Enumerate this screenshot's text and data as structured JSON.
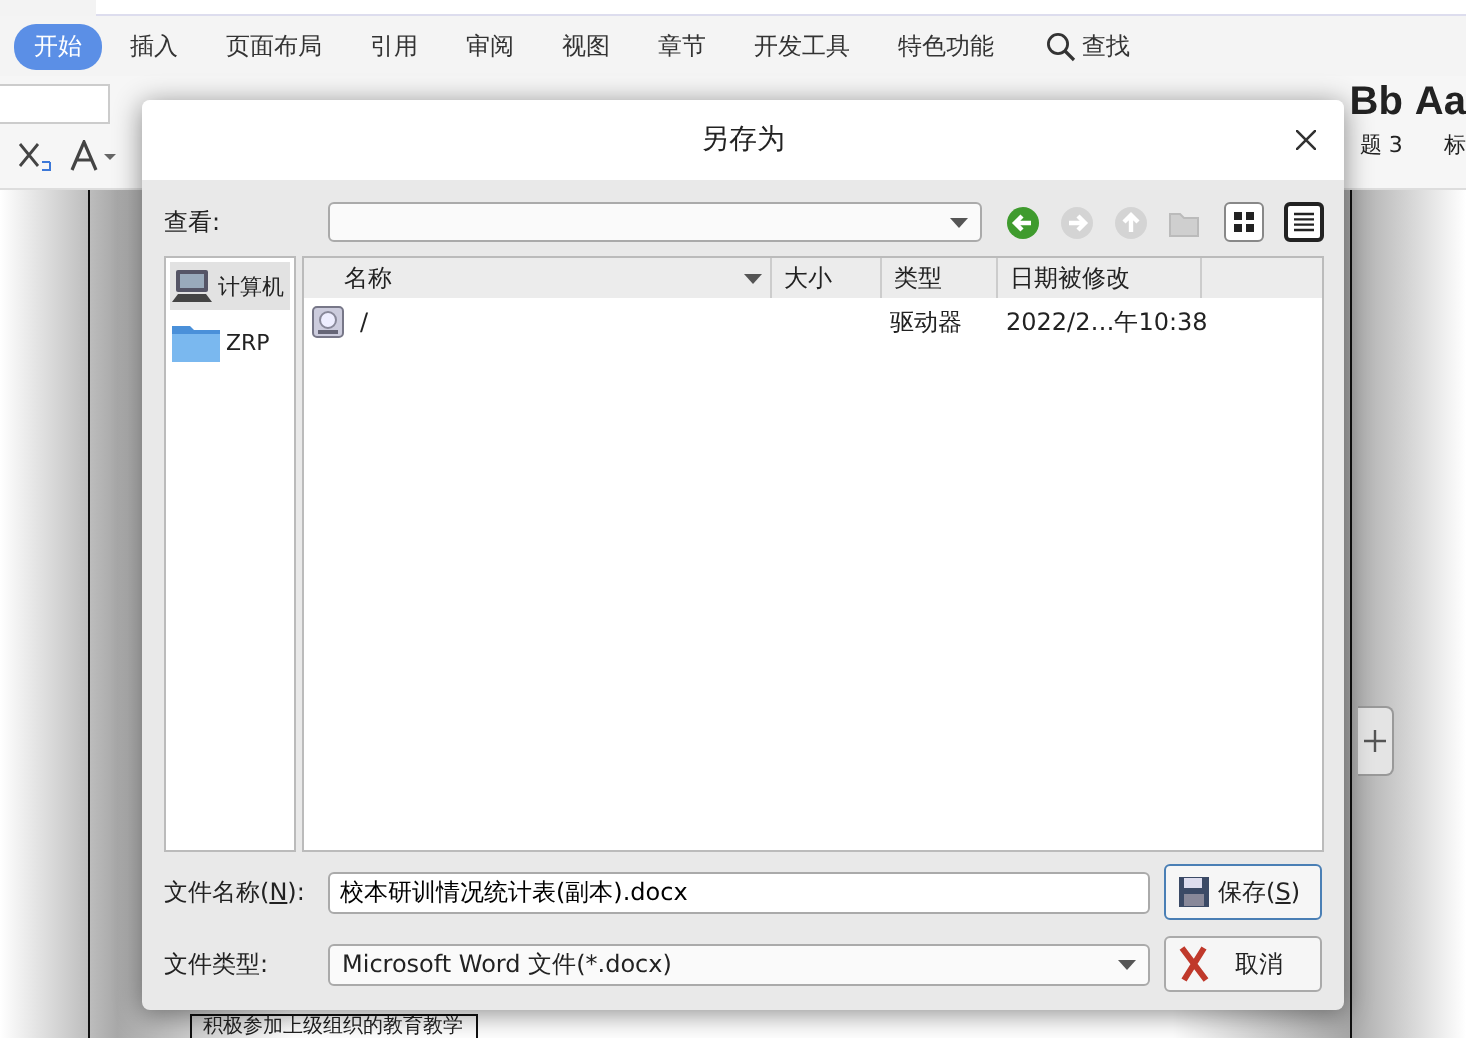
{
  "ribbon": {
    "tabs": [
      {
        "label": "开始",
        "selected": true
      },
      {
        "label": "插入",
        "selected": false
      },
      {
        "label": "页面布局",
        "selected": false
      },
      {
        "label": "引用",
        "selected": false
      },
      {
        "label": "审阅",
        "selected": false
      },
      {
        "label": "视图",
        "selected": false
      },
      {
        "label": "章节",
        "selected": false
      },
      {
        "label": "开发工具",
        "selected": false
      },
      {
        "label": "特色功能",
        "selected": false
      }
    ],
    "search": {
      "label": "查找"
    },
    "style_gallery": [
      {
        "preview": "Bb",
        "caption": "题 3"
      },
      {
        "preview": "Aa",
        "caption": "标"
      }
    ]
  },
  "document": {
    "table_text": "积极参加上级组织的教育教学"
  },
  "dialog": {
    "title": "另存为",
    "look_in": {
      "label": "查看:"
    },
    "nav_buttons": [
      {
        "kind": "back",
        "disabled": false
      },
      {
        "kind": "forward",
        "disabled": true
      },
      {
        "kind": "up",
        "disabled": true
      },
      {
        "kind": "new_folder",
        "disabled": true
      }
    ],
    "view_buttons": [
      {
        "kind": "icons",
        "selected": false
      },
      {
        "kind": "details",
        "selected": true
      }
    ],
    "places": [
      {
        "label": "计算机",
        "kind": "computer",
        "selected": true
      },
      {
        "label": "ZRP",
        "kind": "folder",
        "selected": false
      }
    ],
    "columns": [
      {
        "label": "名称",
        "sorted": true
      },
      {
        "label": "大小",
        "sorted": false
      },
      {
        "label": "类型",
        "sorted": false
      },
      {
        "label": "日期被修改",
        "sorted": false
      }
    ],
    "rows": [
      {
        "name": "/",
        "type": "驱动器",
        "date": "2022/2…午10:38"
      }
    ],
    "filename": {
      "label": {
        "before": "文件名称(",
        "key": "N",
        "after": "):"
      },
      "value": "校本研训情况统计表(副本).docx"
    },
    "filetype": {
      "label": "文件类型:",
      "value": "Microsoft Word 文件(*.docx)"
    },
    "save_button": {
      "before": "保存(",
      "key": "S",
      "after": ")"
    },
    "cancel_button": {
      "label": "取消"
    }
  }
}
